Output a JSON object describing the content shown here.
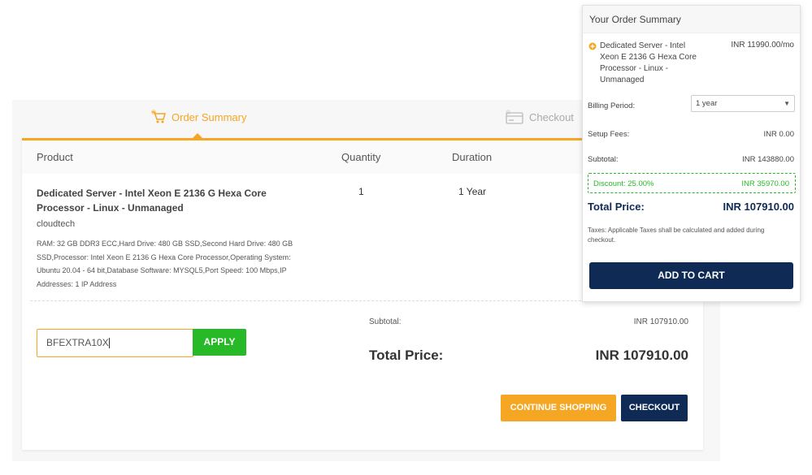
{
  "steps": {
    "order_summary": "Order Summary",
    "checkout": "Checkout"
  },
  "table": {
    "headers": {
      "product": "Product",
      "quantity": "Quantity",
      "duration": "Duration"
    },
    "row": {
      "title": "Dedicated Server - Intel Xeon E 2136 G Hexa Core Processor - Linux - Unmanaged",
      "quantity": "1",
      "duration": "1 Year",
      "vendor": "cloudtech",
      "description": "RAM: 32 GB DDR3 ECC,Hard Drive: 480 GB SSD,Second Hard Drive: 480 GB SSD,Processor: Intel Xeon E 2136 G Hexa Core Processor,Operating System: Ubuntu 20.04 - 64 bit,Database Software: MYSQL5,Port Speed: 100 Mbps,IP Addresses: 1 IP Address"
    }
  },
  "promo": {
    "value": "BFEXTRA10X",
    "apply_label": "APPLY"
  },
  "totals": {
    "subtotal_label": "Subtotal:",
    "subtotal_value": "INR 107910.00",
    "total_label": "Total Price:",
    "total_value": "INR 107910.00"
  },
  "actions": {
    "continue_label": "CONTINUE SHOPPING",
    "checkout_label": "CHECKOUT"
  },
  "summary": {
    "title": "Your Order Summary",
    "item_name": "Dedicated Server - Intel Xeon E 2136 G Hexa Core Processor - Linux - Unmanaged",
    "item_price": "INR 11990.00/mo",
    "billing_label": "Billing Period:",
    "billing_value": "1 year",
    "setup_label": "Setup Fees:",
    "setup_value": "INR 0.00",
    "subtotal_label": "Subtotal:",
    "subtotal_value": "INR 143880.00",
    "discount_label": "Discount: 25.00%",
    "discount_value": "INR 35970.00",
    "total_label": "Total Price:",
    "total_value": "INR 107910.00",
    "taxes_note": "Taxes: Applicable Taxes shall be calculated and added during checkout.",
    "add_to_cart_label": "ADD TO CART"
  },
  "colors": {
    "accent": "#f5a623",
    "navy": "#0f2a55",
    "green": "#27b927"
  }
}
